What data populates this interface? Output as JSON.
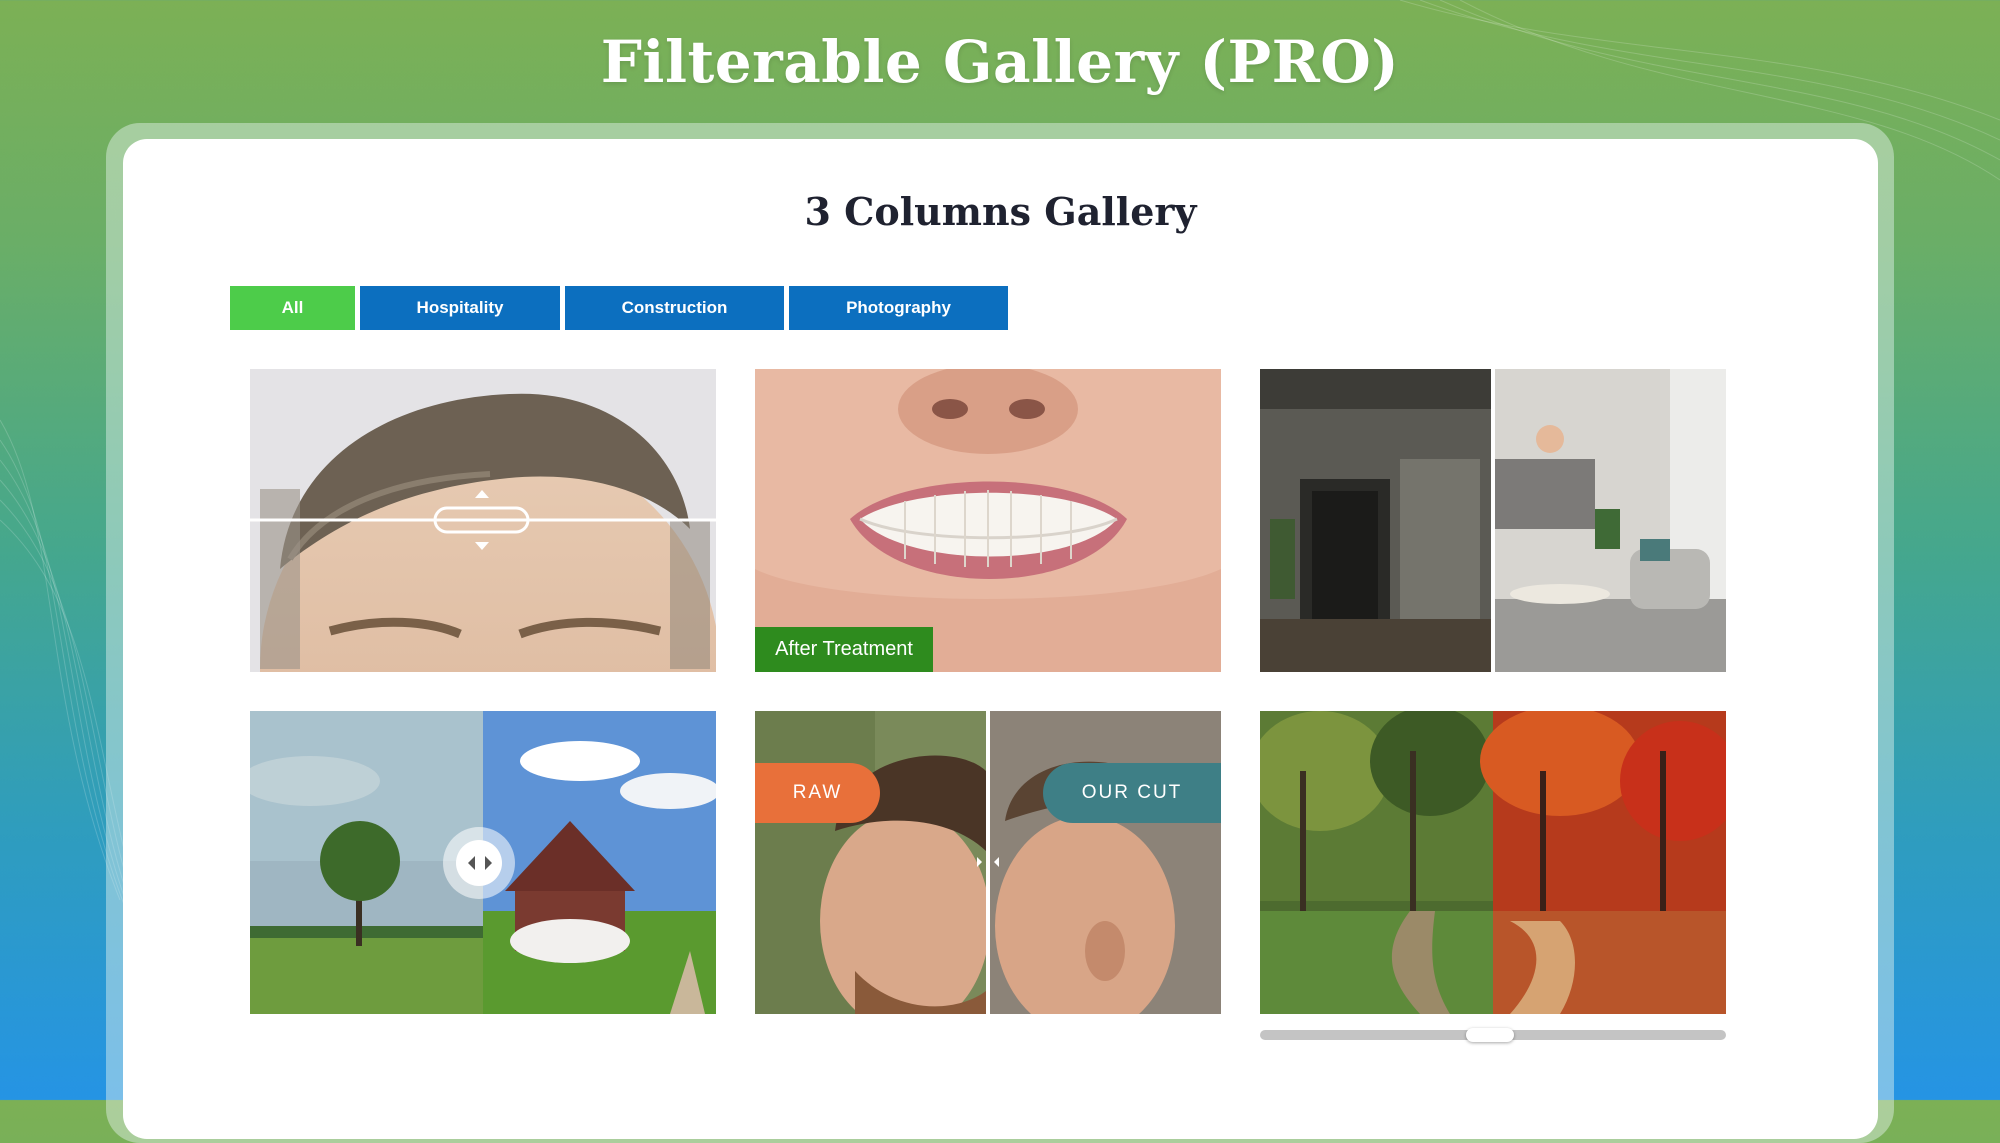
{
  "page": {
    "title": "Filterable Gallery (PRO)"
  },
  "gallery": {
    "title": "3 Columns Gallery",
    "filters": [
      {
        "label": "All",
        "active": true
      },
      {
        "label": "Hospitality",
        "active": false
      },
      {
        "label": "Construction",
        "active": false
      },
      {
        "label": "Photography",
        "active": false
      }
    ],
    "items": [
      {
        "subject": "forehead hairline before/after",
        "slider": "vertical"
      },
      {
        "subject": "smile teeth",
        "label": "After Treatment"
      },
      {
        "subject": "room renovation before/after",
        "slider": "horizontal"
      },
      {
        "subject": "farmhouse landscape before/after",
        "slider": "horizontal-circle"
      },
      {
        "subject": "man haircut",
        "before_label": "RAW",
        "after_label": "OUR CUT"
      },
      {
        "subject": "forest path summer/autumn",
        "slider": "bottom-bar"
      }
    ]
  },
  "colors": {
    "active_filter": "#4dcc4a",
    "filter": "#0c6fbf",
    "after_treatment_badge": "#2e8b1e",
    "raw_badge": "#e8703a",
    "our_cut_badge": "#3e7f86"
  }
}
